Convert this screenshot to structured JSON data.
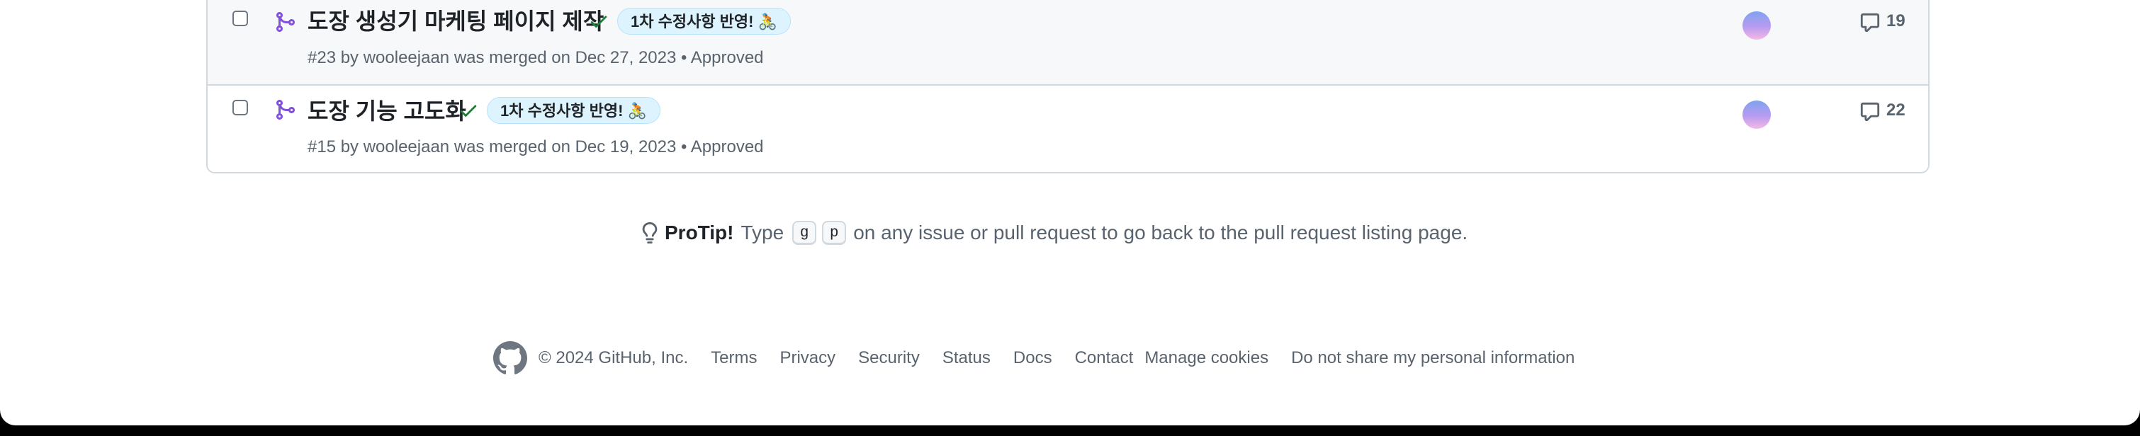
{
  "pull_requests": [
    {
      "title": "도장 생성기 마케팅 페이지 제작",
      "label": "1차 수정사항 반영! 🚴",
      "meta": "#23 by wooleejaan was merged on Dec 27, 2023",
      "review": "Approved",
      "comments": "19"
    },
    {
      "title": "도장 기능 고도화",
      "label": "1차 수정사항 반영! 🚴",
      "meta": "#15 by wooleejaan was merged on Dec 19, 2023",
      "review": "Approved",
      "comments": "22"
    }
  ],
  "protip": {
    "heading": "ProTip!",
    "before": "Type",
    "key1": "g",
    "key2": "p",
    "after": "on any issue or pull request to go back to the pull request listing page."
  },
  "footer": {
    "copyright": "© 2024 GitHub, Inc.",
    "links": [
      "Terms",
      "Privacy",
      "Security",
      "Status",
      "Docs",
      "Contact",
      "Manage cookies",
      "Do not share my personal information"
    ]
  },
  "colors": {
    "merged": "#8250df",
    "success": "#1a7f37",
    "label_bg": "#ddf4ff",
    "muted": "#59636e"
  }
}
